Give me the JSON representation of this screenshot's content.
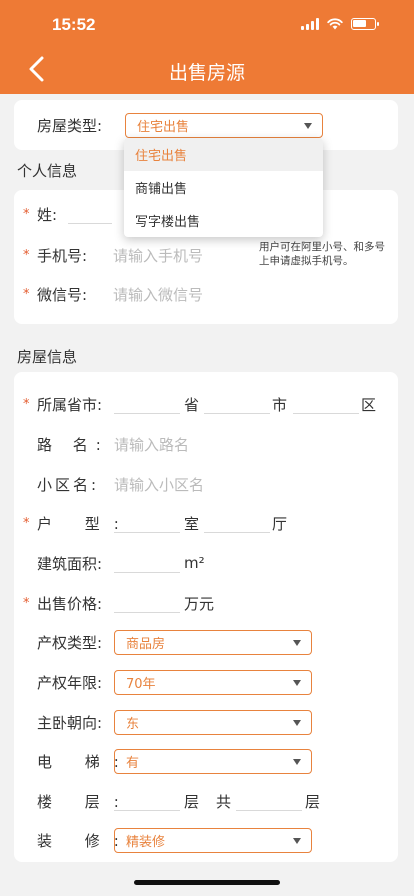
{
  "status_bar": {
    "time": "15:52"
  },
  "nav": {
    "title": "出售房源"
  },
  "house_type": {
    "label": "房屋类型:",
    "selected": "住宅出售",
    "options": [
      "住宅出售",
      "商铺出售",
      "写字楼出售"
    ]
  },
  "personal": {
    "title": "个人信息",
    "surname_label": "姓:",
    "phone_label": "手机号:",
    "phone_placeholder": "请输入手机号",
    "phone_hint": "用户可在阿里小号、和多号上申请虚拟手机号。",
    "wechat_label": "微信号:",
    "wechat_placeholder": "请输入微信号"
  },
  "house_info": {
    "title": "房屋信息",
    "region_label": "所属省市:",
    "province_unit": "省",
    "city_unit": "市",
    "district_unit": "区",
    "road_label": "路 名:",
    "road_placeholder": "请输入路名",
    "community_label": "小区名:",
    "community_placeholder": "请输入小区名",
    "layout_label": "户 型:",
    "room_unit": "室",
    "hall_unit": "厅",
    "area_label": "建筑面积:",
    "area_unit": "m²",
    "price_label": "出售价格:",
    "price_unit": "万元",
    "property_type_label": "产权类型:",
    "property_type_value": "商品房",
    "property_years_label": "产权年限:",
    "property_years_value": "70年",
    "orientation_label": "主卧朝向:",
    "orientation_value": "东",
    "elevator_label": "电 梯:",
    "elevator_value": "有",
    "floor_label": "楼 层:",
    "floor_unit": "层",
    "total_label": "共",
    "total_unit": "层",
    "decoration_label": "装 修:",
    "decoration_value": "精装修"
  },
  "colors": {
    "accent": "#ee7a35",
    "required": "#e45c2f",
    "select_border": "#e8833e"
  }
}
